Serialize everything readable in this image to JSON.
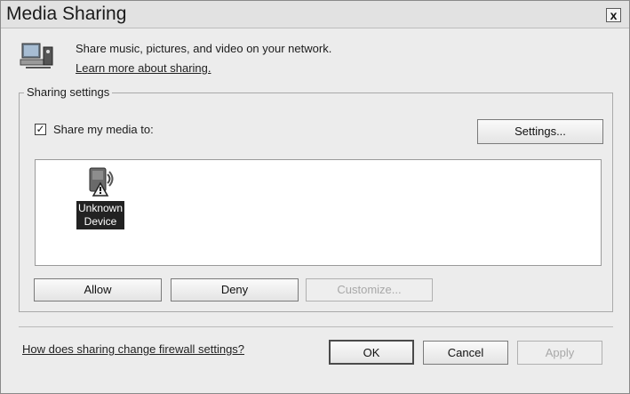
{
  "window": {
    "title": "Media Sharing",
    "close_label": "x"
  },
  "header": {
    "description": "Share music, pictures, and video on your network.",
    "learn_more_link": "Learn more about sharing."
  },
  "sharing": {
    "group_label": "Sharing settings",
    "share_checkbox_checked": true,
    "share_label": "Share my media to:",
    "settings_button": "Settings...",
    "devices": [
      {
        "line1": "Unknown",
        "line2": "Device",
        "icon": "unknown-device-warning-icon"
      }
    ],
    "allow_button": "Allow",
    "deny_button": "Deny",
    "customize_button": "Customize..."
  },
  "footer": {
    "firewall_link": "How does sharing change firewall settings?",
    "ok_button": "OK",
    "cancel_button": "Cancel",
    "apply_button": "Apply"
  }
}
